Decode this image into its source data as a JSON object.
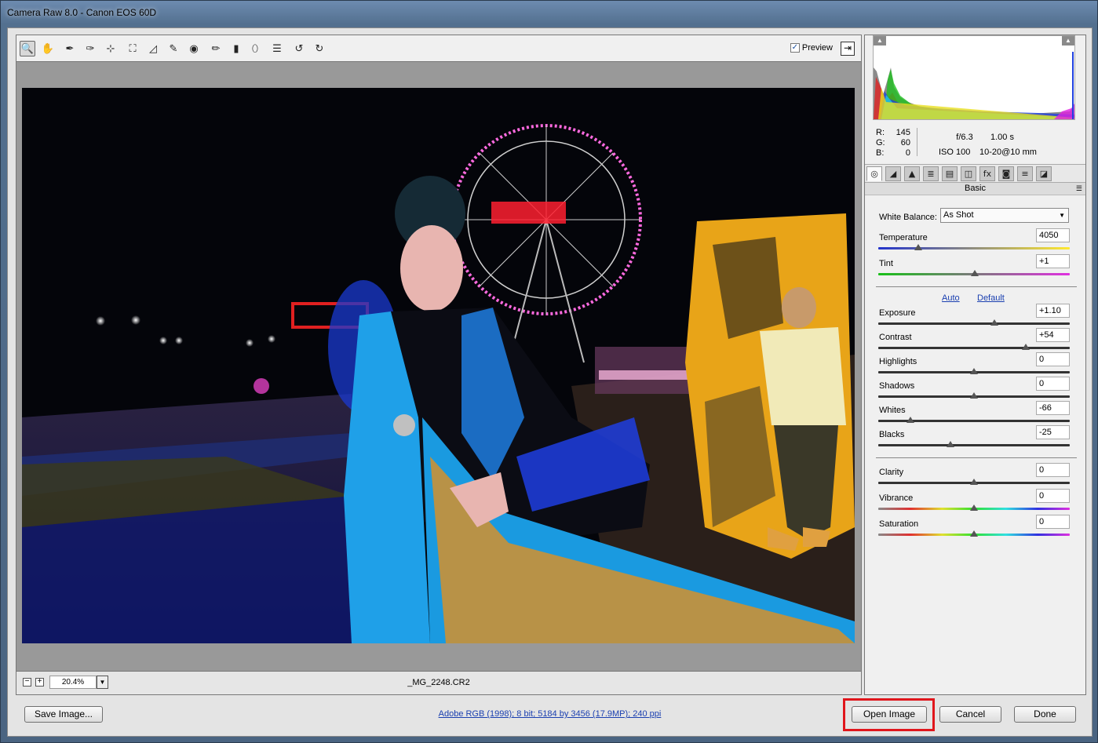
{
  "window": {
    "title": "Camera Raw 8.0  -  Canon EOS 60D"
  },
  "toolbar": {
    "tools": [
      {
        "name": "zoom-tool-icon",
        "glyph": "🔍"
      },
      {
        "name": "hand-tool-icon",
        "glyph": "✋"
      },
      {
        "name": "white-balance-tool-icon",
        "glyph": "✒"
      },
      {
        "name": "color-sampler-tool-icon",
        "glyph": "✑"
      },
      {
        "name": "targeted-adjustment-tool-icon",
        "glyph": "⊹"
      },
      {
        "name": "crop-tool-icon",
        "glyph": "⛶"
      },
      {
        "name": "straighten-tool-icon",
        "glyph": "◿"
      },
      {
        "name": "spot-removal-tool-icon",
        "glyph": "✎"
      },
      {
        "name": "red-eye-removal-icon",
        "glyph": "◉"
      },
      {
        "name": "adjustment-brush-icon",
        "glyph": "✏"
      },
      {
        "name": "graduated-filter-icon",
        "glyph": "▮"
      },
      {
        "name": "radial-filter-icon",
        "glyph": "⬯"
      },
      {
        "name": "preferences-icon",
        "glyph": "☰"
      },
      {
        "name": "rotate-left-icon",
        "glyph": "↺"
      },
      {
        "name": "rotate-right-icon",
        "glyph": "↻"
      }
    ],
    "preview_label": "Preview",
    "preview_checked": "✓",
    "fullscreen_glyph": "⇥"
  },
  "status": {
    "zoom_minus": "−",
    "zoom_plus": "+",
    "zoom_value": "20.4%",
    "zoom_dropdown": "▼",
    "filename": "_MG_2248.CR2"
  },
  "readout": {
    "r_label": "R:",
    "r_value": "145",
    "g_label": "G:",
    "g_value": "60",
    "b_label": "B:",
    "b_value": "0",
    "aperture": "f/6.3",
    "shutter": "1.00 s",
    "iso": "ISO 100",
    "lens": "10-20@10 mm"
  },
  "panel": {
    "tabs": [
      "◎",
      "◢",
      "▲",
      "≣",
      "▤",
      "◫",
      "fx",
      "◙",
      "≡",
      "◪"
    ],
    "tab_names": [
      "basic-tab-icon",
      "tone-curve-tab-icon",
      "detail-tab-icon",
      "hsl-tab-icon",
      "split-toning-tab-icon",
      "lens-corrections-tab-icon",
      "effects-tab-icon",
      "camera-calibration-tab-icon",
      "presets-tab-icon",
      "snapshots-tab-icon"
    ],
    "section_title": "Basic",
    "menu_glyph": "☰",
    "white_balance_label": "White Balance:",
    "white_balance_value": "As Shot",
    "auto_label": "Auto",
    "default_label": "Default",
    "sliders": {
      "temperature": {
        "label": "Temperature",
        "value": "4050",
        "fraction": 0.21
      },
      "tint": {
        "label": "Tint",
        "value": "+1",
        "fraction": 0.505
      },
      "exposure": {
        "label": "Exposure",
        "value": "+1.10",
        "fraction": 0.605
      },
      "contrast": {
        "label": "Contrast",
        "value": "+54",
        "fraction": 0.77
      },
      "highlights": {
        "label": "Highlights",
        "value": "0",
        "fraction": 0.5
      },
      "shadows": {
        "label": "Shadows",
        "value": "0",
        "fraction": 0.5
      },
      "whites": {
        "label": "Whites",
        "value": "-66",
        "fraction": 0.17
      },
      "blacks": {
        "label": "Blacks",
        "value": "-25",
        "fraction": 0.375
      },
      "clarity": {
        "label": "Clarity",
        "value": "0",
        "fraction": 0.5
      },
      "vibrance": {
        "label": "Vibrance",
        "value": "0",
        "fraction": 0.5
      },
      "saturation": {
        "label": "Saturation",
        "value": "0",
        "fraction": 0.5
      }
    }
  },
  "footer": {
    "save_label": "Save Image...",
    "workflow_link": "Adobe RGB (1998); 8 bit; 5184 by 3456 (17.9MP); 240 ppi",
    "open_label": "Open Image",
    "cancel_label": "Cancel",
    "done_label": "Done"
  },
  "colors": {
    "highlight": "#e0161c",
    "link": "#1a3fb0"
  }
}
